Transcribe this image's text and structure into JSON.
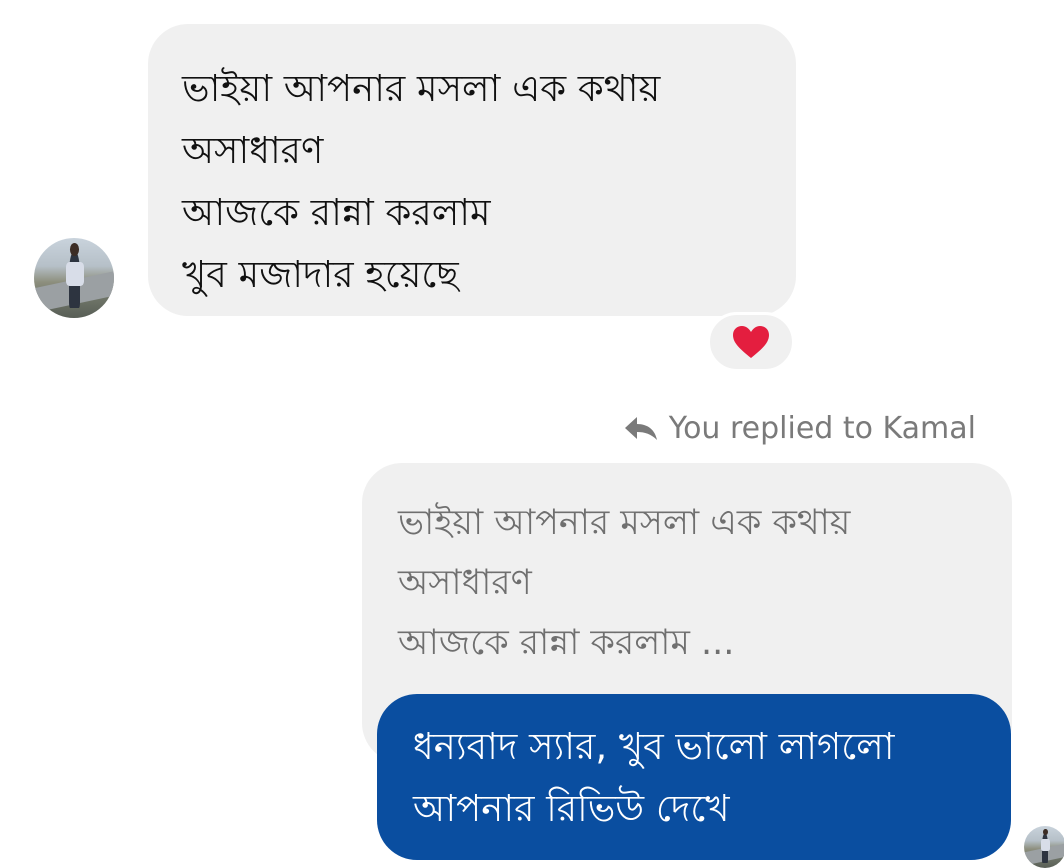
{
  "chat": {
    "incoming": {
      "sender_avatar": "avatar-photo",
      "lines": [
        "ভাইয়া আপনার মসলা এক কথায়",
        "অসাধারণ",
        "আজকে রান্না করলাম",
        "খুব মজাদার হয়েছে"
      ],
      "reaction": "heart-icon",
      "reaction_color": "#e41e3f"
    },
    "reply": {
      "label": "You replied to Kamal",
      "icon": "reply-arrow-icon",
      "quoted_lines": [
        "ভাইয়া আপনার মসলা এক কথায়",
        "অসাধারণ",
        "আজকে রান্না করলাম ..."
      ],
      "message_lines": [
        "ধন্যবাদ স্যার, খুব ভালো লাগলো",
        "আপনার রিভিউ দেখে"
      ],
      "bubble_color": "#0a4ea0",
      "read_receipt_avatar": "avatar-photo"
    }
  }
}
